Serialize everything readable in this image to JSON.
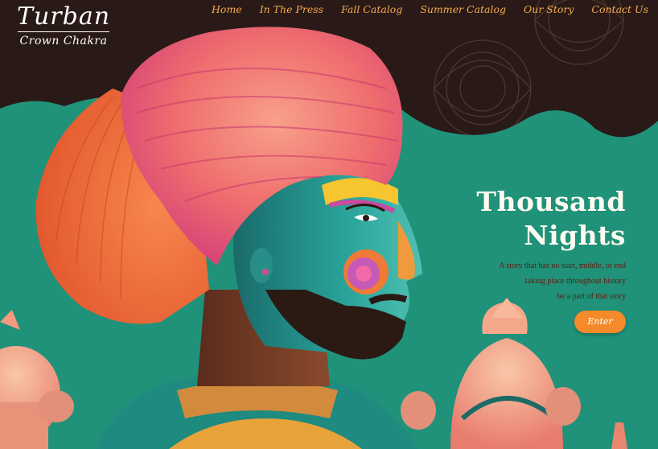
{
  "brand": {
    "title": "Turban",
    "subtitle": "Crown Chakra"
  },
  "nav": {
    "items": [
      {
        "label": "Home"
      },
      {
        "label": "In The Press"
      },
      {
        "label": "Fall Catalog"
      },
      {
        "label": "Summer Catalog"
      },
      {
        "label": "Our Story"
      },
      {
        "label": "Contact Us"
      }
    ]
  },
  "hero": {
    "title_line1": "Thousand",
    "title_line2": "Nights",
    "desc_line1": "A story that has no start, middle, or end",
    "desc_line2": "taking place throughout history",
    "desc_line3": "be a part of that story",
    "cta_label": "Enter"
  },
  "colors": {
    "background_top": "#2a1a17",
    "teal": "#1f9279",
    "nav_text": "#f4a94f",
    "cta": "#f58a2a",
    "turban": "#f2716d"
  },
  "image": {
    "subject": "illustrated-man-with-turban"
  }
}
